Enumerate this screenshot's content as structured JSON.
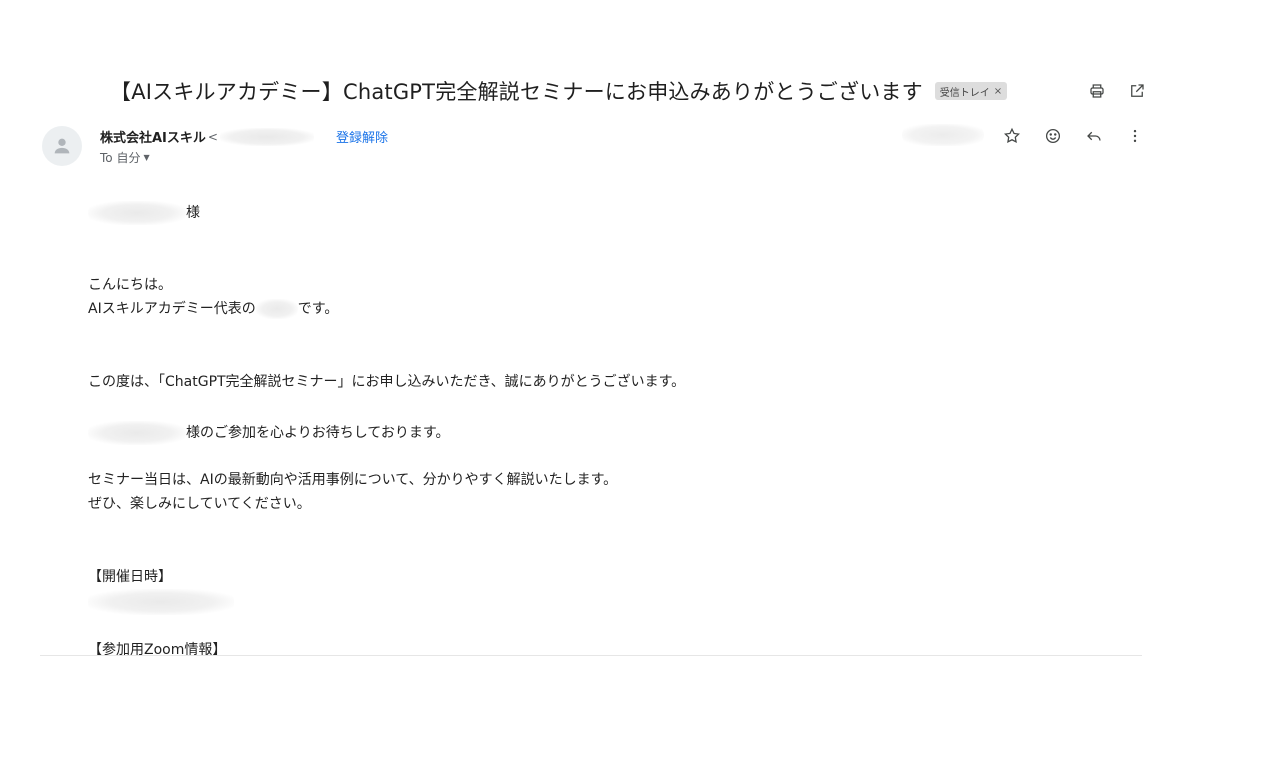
{
  "email": {
    "subject": "【AIスキルアカデミー】ChatGPT完全解説セミナーにお申込みありがとうございます",
    "label": "受信トレイ",
    "label_remove": "×",
    "sender_name": "株式会社AIスキル",
    "sender_email_lt": "<",
    "unsubscribe": "登録解除",
    "to": "To 自分",
    "to_caret": "▼"
  },
  "body": {
    "greeting_suffix": "様",
    "hello": "こんにちは。",
    "intro_prefix": "AIスキルアカデミー代表の",
    "intro_suffix": "です。",
    "thanks": "この度は、「ChatGPT完全解説セミナー」にお申し込みいただき、誠にありがとうございます。",
    "wait_suffix": "様のご参加を心よりお待ちしております。",
    "content_1": "セミナー当日は、AIの最新動向や活用事例について、分かりやすく解説いたします。",
    "content_2": "ぜひ、楽しみにしていてください。",
    "date_heading": "【開催日時】",
    "zoom_heading": "【参加用Zoom情報】"
  },
  "icons": {
    "print": "printer-icon",
    "open_new": "open-in-new-icon",
    "star": "star-icon",
    "emoji": "emoji-icon",
    "reply": "reply-icon",
    "more": "more-vert-icon",
    "avatar": "person-icon"
  },
  "colors": {
    "link": "#1a73e8",
    "label_bg": "#dddddd",
    "text": "#222222"
  }
}
